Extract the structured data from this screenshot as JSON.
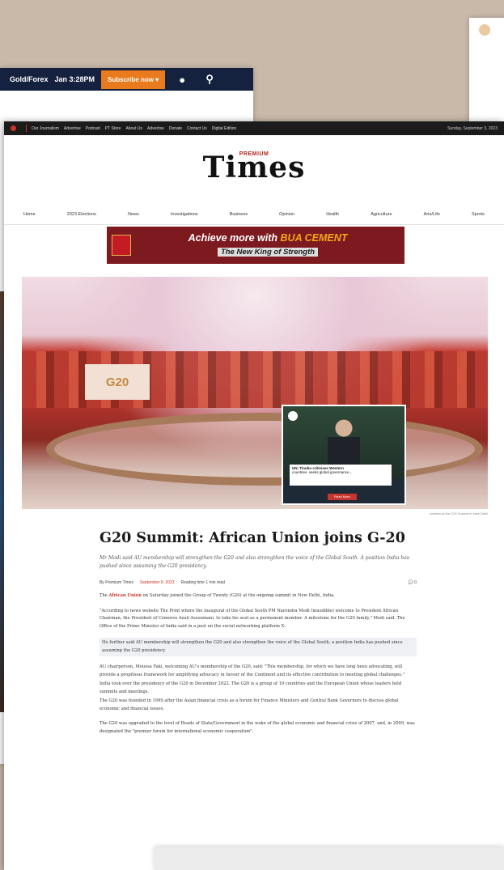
{
  "background_window_left": {
    "topbar": [
      "Gold/Forex",
      "Jan 3:28PM"
    ],
    "subscribe_label": "Subscribe now ▾",
    "accent": "#14213f",
    "subscribe_color": "#e97a1d"
  },
  "site": {
    "util_links": [
      "Our Journalism",
      "Advertise",
      "Podcast",
      "PT Store",
      "About Us",
      "Advertise",
      "Donate",
      "Contact Us",
      "Digital Edition"
    ],
    "date": "Sunday, September 3, 2023",
    "premium_label": "PREMIUM",
    "logo": "Times",
    "nav": [
      "Home",
      "2023 Elections",
      "News",
      "Investigations",
      "Business",
      "Opinion",
      "Health",
      "Agriculture",
      "Arts/Life",
      "Sports"
    ],
    "brand_red": "#c9342c"
  },
  "ad": {
    "line1_prefix": "Achieve more with ",
    "line1_brand": "BUA CEMENT",
    "line2": "The New King of Strength",
    "logo_text": "BUA"
  },
  "hero": {
    "sign_text": "G20",
    "caption": "Leaders at the G20 Summit in New Delhi",
    "video": {
      "title": "UN: Tinubu criticises Western",
      "subtitle": "countries, seeks global governance...",
      "button": "Read More"
    }
  },
  "article": {
    "title": "G20 Summit: African Union joins G-20",
    "subtitle": "Mr Modi said AU membership will strengthen the G20 and also strengthen the voice of the Global South. A position India has pushed since assuming the G20 presidency.",
    "byline": {
      "author": "By Premium Times",
      "date": "September 9, 2023",
      "reading": "Reading time 1 min read",
      "comments": "0"
    },
    "p1_prefix": "The ",
    "p1_link": "African Union",
    "p1_rest": " on Saturday joined the Group of Twenty (G20) at the ongoing summit in New Delhi, India.",
    "p2": "\"According to news website The Print where the inaugural of the Global South PM Narendra Modi (inaudible) welcome to President African Chairman, the President of Comoros Azali Assoumani, to take his seat as a permanent member. A milestone for the G20 family,\" Modi said. The Office of the Prime Minister of India said in a post on the social networking platform X.",
    "p3": "He further said AU membership will strengthen the G20 and also strengthen the voice of the Global South, a position India has pushed since assuming the G20 presidency.",
    "p4": "AU chairperson, Moussa Faki, welcoming AU's membership of the G20, said: \"This membership, for which we have long been advocating, will provide a propitious framework for amplifying advocacy in favour of the Continent and its effective contribution to meeting global challenges.\"",
    "p5": "India took over the presidency of the G20 in December 2022. The G20 is a group of 19 countries and the European Union whose leaders hold summits and meetings.",
    "p6": "The G20 was founded in 1999 after the Asian financial crisis as a forum for Finance Ministers and Central Bank Governors to discuss global economic and financial issues.",
    "p7": "The G20 was upgraded to the level of Heads of State/Government in the wake of the global economic and financial crisis of 2007, and, in 2009, was designated the \"premier forum for international economic cooperation\"."
  }
}
